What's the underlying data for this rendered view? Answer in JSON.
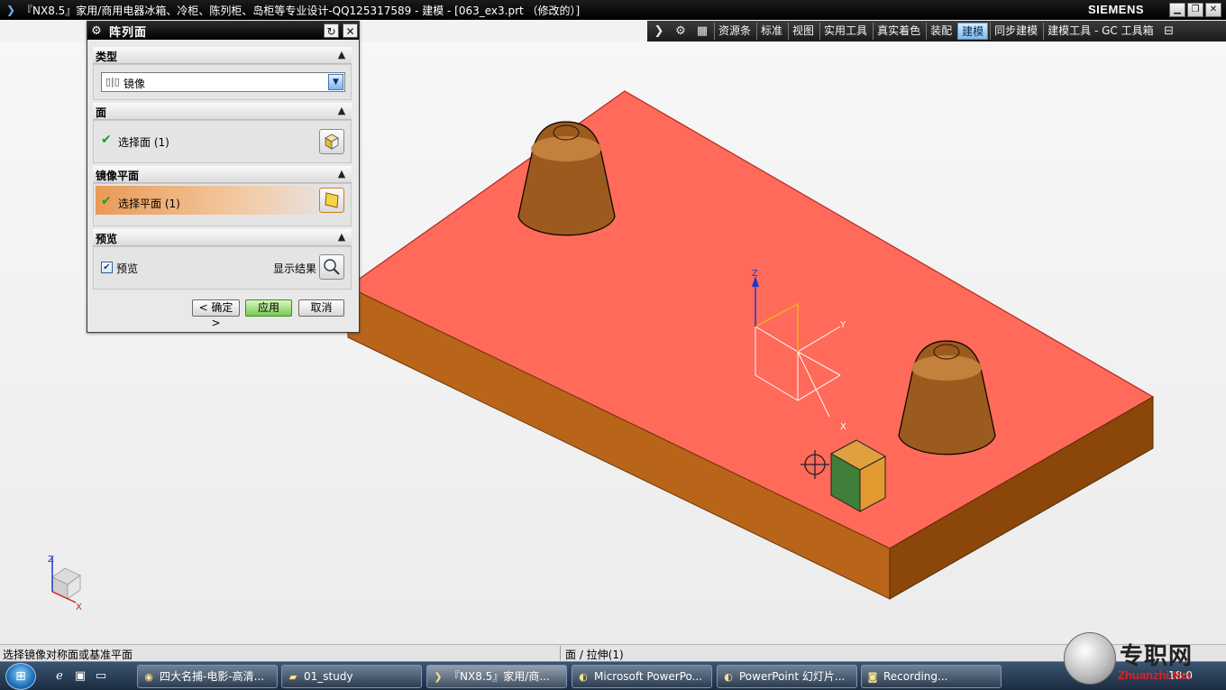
{
  "window": {
    "title": "『NX8.5』家用/商用电器冰箱、冷柜、陈列柜、岛柜等专业设计-QQ125317589 - 建模 - [063_ex3.prt （修改的）]",
    "brand": "SIEMENS",
    "icons": {
      "app": "nx-logo-icon",
      "minimize": "minimize-icon",
      "restore": "restore-icon",
      "close": "close-icon"
    }
  },
  "toolbar": {
    "tabs": [
      "资源条",
      "标准",
      "视图",
      "实用工具",
      "真实着色",
      "装配",
      "建模",
      "同步建模",
      "建模工具 - GC 工具箱"
    ],
    "active_tab": "建模",
    "icons": [
      "nx-logo-icon",
      "gear-icon",
      "grid-icon",
      "menu-icon"
    ]
  },
  "dialog": {
    "title": "阵列面",
    "sections": {
      "type": {
        "label": "类型",
        "value": "镜像"
      },
      "face": {
        "label": "面",
        "select_label": "选择面 (1)"
      },
      "mirror_plane": {
        "label": "镜像平面",
        "select_label": "选择平面 (1)"
      },
      "preview": {
        "label": "预览",
        "checkbox_label": "预览",
        "checked": true,
        "show_result_label": "显示结果"
      }
    },
    "buttons": {
      "ok": "< 确定 >",
      "apply": "应用",
      "cancel": "取消"
    }
  },
  "viewport": {
    "csys_axes": [
      "Z",
      "Y",
      "X"
    ],
    "triad_axes": [
      "Z",
      "X"
    ],
    "colors": {
      "top_face": "#ff6a5a",
      "side_face": "#a95a14",
      "highlight": "#f2a030",
      "cube_green": "#3f7f3a"
    }
  },
  "status": {
    "prompt": "选择镜像对称面或基准平面",
    "selection": "面 / 拉伸(1)"
  },
  "taskbar": {
    "start_icon": "windows-orb-icon",
    "quick_launch": [
      "ie-icon",
      "desktop-icon",
      "monitor-icon"
    ],
    "tasks": [
      {
        "label": "四大名捕-电影-高清...",
        "icon": "browser-icon"
      },
      {
        "label": "01_study",
        "icon": "folder-icon"
      },
      {
        "label": "『NX8.5』家用/商...",
        "icon": "nx-logo-icon",
        "active": true
      },
      {
        "label": "Microsoft PowerPo...",
        "icon": "powerpoint-icon"
      },
      {
        "label": "PowerPoint 幻灯片...",
        "icon": "powerpoint-icon"
      },
      {
        "label": "Recording...",
        "icon": "recording-icon"
      }
    ],
    "clock": "18:0",
    "watermark_text": "专职网",
    "watermark_url": "Zhuanzhi.Net"
  }
}
